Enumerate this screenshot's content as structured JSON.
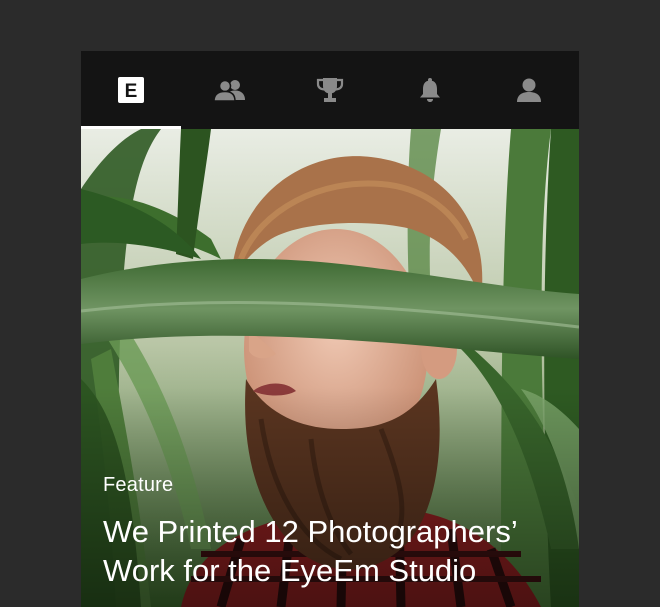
{
  "tabs": [
    {
      "icon": "eyeem-logo-icon",
      "letter": "E",
      "active": true
    },
    {
      "icon": "people-icon",
      "active": false
    },
    {
      "icon": "trophy-icon",
      "active": false
    },
    {
      "icon": "bell-icon",
      "active": false
    },
    {
      "icon": "profile-icon",
      "active": false
    }
  ],
  "feature": {
    "eyebrow": "Feature",
    "headline": "We Printed 12 Photographers’ Work for the EyeEm Studio"
  },
  "colors": {
    "background": "#2b2b2b",
    "tabbar": "#141414",
    "icon_inactive": "#8a8a8a",
    "active_underline": "#ffffff"
  }
}
